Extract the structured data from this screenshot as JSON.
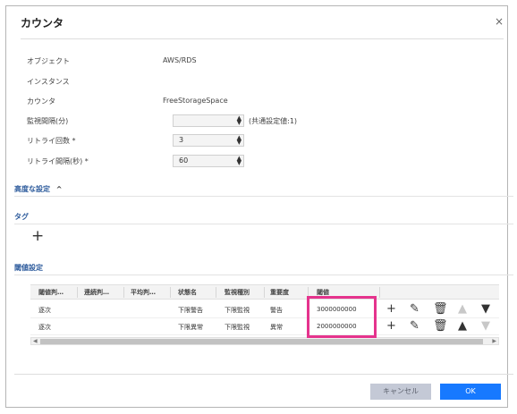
{
  "dialog": {
    "title": "カウンタ",
    "close_icon": "×"
  },
  "rows": [
    {
      "label": "オブジェクト",
      "value": "AWS/RDS"
    },
    {
      "label": "インスタンス",
      "value": ""
    },
    {
      "label": "カウンタ",
      "value": "FreeStorageSpace"
    },
    {
      "label": "監視間隔(分)",
      "value": ""
    },
    {
      "label": "リトライ回数 *",
      "value": "3"
    },
    {
      "label": "リトライ間隔(秒) *",
      "value": "60"
    }
  ],
  "interval_note": "(共通設定値:1)",
  "advanced": {
    "label": "高度な設定",
    "chevron": "^"
  },
  "tag": {
    "label": "タグ",
    "add_icon": "+"
  },
  "threshold": {
    "label": "閾値設定",
    "columns": [
      "閾値判…",
      "連続判…",
      "平均判…",
      "状態名",
      "監視種別",
      "重要度",
      "閾値"
    ],
    "rows": [
      {
        "cells": [
          "逐次",
          "",
          "",
          "下限警告",
          "下限監視",
          "警告",
          "3000000000"
        ],
        "up_enabled": false,
        "down_enabled": true
      },
      {
        "cells": [
          "逐次",
          "",
          "",
          "下限異常",
          "下限監視",
          "異常",
          "2000000000"
        ],
        "up_enabled": true,
        "down_enabled": false
      }
    ],
    "actions": {
      "add": "+",
      "edit": "✎",
      "delete": "🗑",
      "up": "▲",
      "down": "▼"
    }
  },
  "footer": {
    "cancel": "キャンセル",
    "ok": "OK"
  },
  "colors": {
    "accent": "#1779ff",
    "highlight": "#e5338d",
    "section": "#2d5b9c"
  }
}
